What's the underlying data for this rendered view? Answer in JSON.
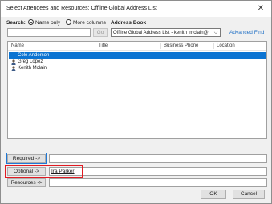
{
  "window": {
    "title": "Select Attendees and Resources: Offline Global Address List",
    "close_glyph": "✕"
  },
  "search": {
    "label": "Search:",
    "option_name_only": "Name only",
    "option_more_columns": "More columns",
    "selected_option": "Name only",
    "value": "",
    "go_label": "Go"
  },
  "address_book": {
    "label": "Address Book",
    "selected": "Offline Global Address List - kenith_mclain@",
    "advanced_find": "Advanced Find"
  },
  "list": {
    "columns": [
      "Name",
      "Title",
      "Business Phone",
      "Location"
    ],
    "rows": [
      {
        "name": "Cole Anderson",
        "selected": true
      },
      {
        "name": "Greg Lopez",
        "selected": false
      },
      {
        "name": "Kenith Mclain",
        "selected": false
      }
    ]
  },
  "recipients": {
    "required_label": "Required ->",
    "required_value": "",
    "optional_label": "Optional ->",
    "optional_value": "Ira Parker",
    "resources_label": "Resources ->",
    "resources_value": ""
  },
  "footer": {
    "ok_label": "OK",
    "cancel_label": "Cancel"
  },
  "colors": {
    "selection": "#0c74d2",
    "highlight_red": "#e11b22",
    "highlight_blue": "#1f78d6",
    "link": "#1f6fc5"
  }
}
